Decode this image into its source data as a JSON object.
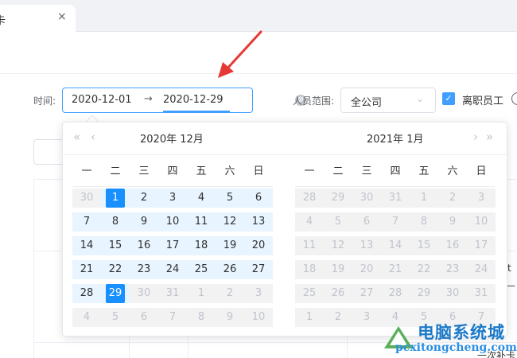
{
  "tab": {
    "label": "卡",
    "close": "×"
  },
  "filters": {
    "time_label": "时间:",
    "start_date": "2020-12-01",
    "range_separator": "→",
    "end_date": "2020-12-29",
    "clear_icon": "⊗",
    "scope_label": "人员范围:",
    "scope_value": "全公司",
    "dropdown_icon": "⌄",
    "checkbox_checked": true,
    "checkbox_label": "离职员工",
    "info_icon": "i"
  },
  "background": {
    "snippet1": "t",
    "snippet2": "—",
    "snippet3": "一次补卡"
  },
  "picker": {
    "nav_prev_year": "«",
    "nav_prev_month": "‹",
    "nav_next_month": "›",
    "nav_next_year": "»",
    "left": {
      "title": "2020年  12月"
    },
    "right": {
      "title": "2021年  1月"
    },
    "weekdays": [
      "一",
      "二",
      "三",
      "四",
      "五",
      "六",
      "日"
    ],
    "left_days": [
      [
        "30",
        "1",
        "2",
        "3",
        "4",
        "5",
        "6"
      ],
      [
        "7",
        "8",
        "9",
        "10",
        "11",
        "12",
        "13"
      ],
      [
        "14",
        "15",
        "16",
        "17",
        "18",
        "19",
        "20"
      ],
      [
        "21",
        "22",
        "23",
        "24",
        "25",
        "26",
        "27"
      ],
      [
        "28",
        "29",
        "30",
        "31",
        "1",
        "2",
        "3"
      ],
      [
        "4",
        "5",
        "6",
        "7",
        "8",
        "9",
        "10"
      ]
    ],
    "right_days": [
      [
        "28",
        "29",
        "30",
        "31",
        "1",
        "2",
        "3"
      ],
      [
        "4",
        "5",
        "6",
        "7",
        "8",
        "9",
        "10"
      ],
      [
        "11",
        "12",
        "13",
        "14",
        "15",
        "16",
        "17"
      ],
      [
        "18",
        "19",
        "20",
        "21",
        "22",
        "23",
        "24"
      ],
      [
        "25",
        "26",
        "27",
        "28",
        "29",
        "30",
        "31"
      ],
      [
        "1",
        "2",
        "3",
        "4",
        "5",
        "6",
        "7"
      ]
    ],
    "selected_start": "1",
    "selected_end": "29"
  },
  "colors": {
    "accent": "#409eff",
    "selected": "#1890ff",
    "range_bg": "#e8f4ff",
    "disabled_bg": "#f2f2f2",
    "arrow": "#e53935"
  },
  "watermark": {
    "title": "电脑系统城",
    "url": "pcxitongcheng.com"
  }
}
